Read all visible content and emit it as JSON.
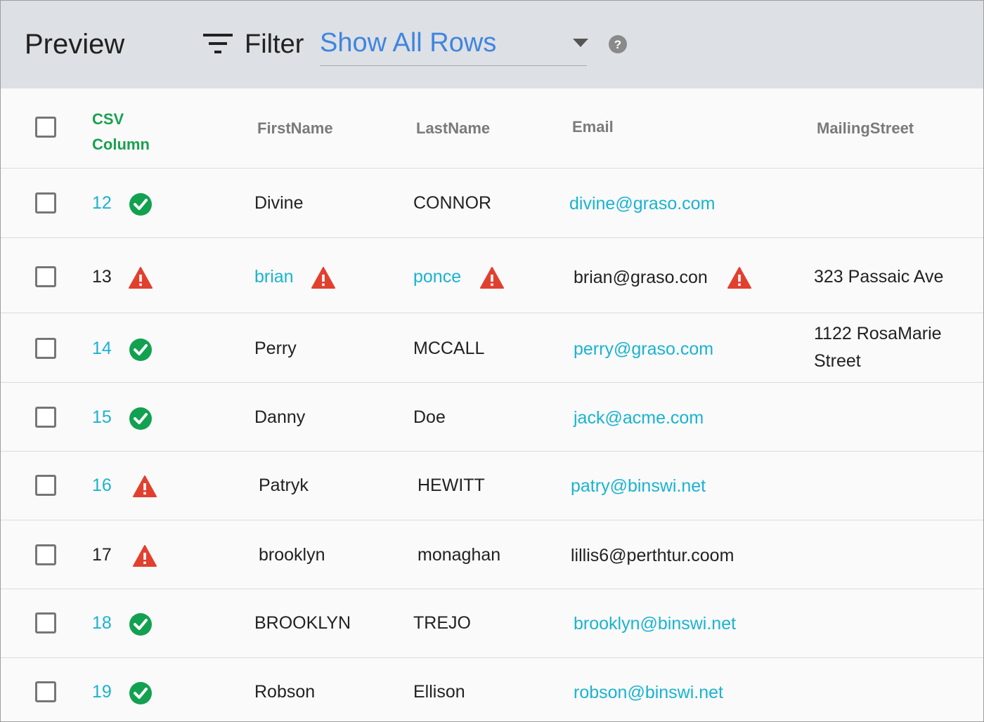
{
  "header": {
    "title": "Preview",
    "filter_label": "Filter",
    "filter_value": "Show All Rows"
  },
  "columns": {
    "csv_line1": "CSV",
    "csv_line2": "Column",
    "firstname": "FirstName",
    "lastname": "LastName",
    "email": "Email",
    "mailingstreet": "MailingStreet"
  },
  "colors": {
    "ok": "#12a150",
    "warning": "#e2402f",
    "link": "#1ab3d0",
    "filter_value": "#3f85e0",
    "header_bg": "#dde0e4"
  },
  "rows": [
    {
      "csv": "12",
      "status": "check-circle-icon",
      "firstname": "Divine",
      "lastname": "CONNOR",
      "email": "divine@graso.com",
      "mailingstreet": ""
    },
    {
      "csv": "13",
      "status": "warning-icon",
      "firstname": "brian",
      "firstname_warning": true,
      "lastname": "ponce",
      "lastname_warning": true,
      "email": "brian@graso.con",
      "email_warning": true,
      "mailingstreet": "323 Passaic Ave"
    },
    {
      "csv": "14",
      "status": "check-circle-icon",
      "firstname": "Perry",
      "lastname": "MCCALL",
      "email": "perry@graso.com",
      "mailingstreet": "1122 RosaMarie Street"
    },
    {
      "csv": "15",
      "status": "check-circle-icon",
      "firstname": "Danny",
      "lastname": "Doe",
      "email": "jack@acme.com",
      "mailingstreet": ""
    },
    {
      "csv": "16",
      "status": "warning-icon",
      "firstname": "Patryk",
      "lastname": "HEWITT",
      "email": "patry@binswi.net",
      "mailingstreet": ""
    },
    {
      "csv": "17",
      "status": "warning-icon",
      "firstname": "brooklyn",
      "lastname": "monaghan",
      "email": "lillis6@perthtur.coom",
      "mailingstreet": ""
    },
    {
      "csv": "18",
      "status": "check-circle-icon",
      "firstname": "BROOKLYN",
      "lastname": "TREJO",
      "email": "brooklyn@binswi.net",
      "mailingstreet": ""
    },
    {
      "csv": "19",
      "status": "check-circle-icon",
      "firstname": "Robson",
      "lastname": "Ellison",
      "email": "robson@binswi.net",
      "mailingstreet": ""
    }
  ]
}
